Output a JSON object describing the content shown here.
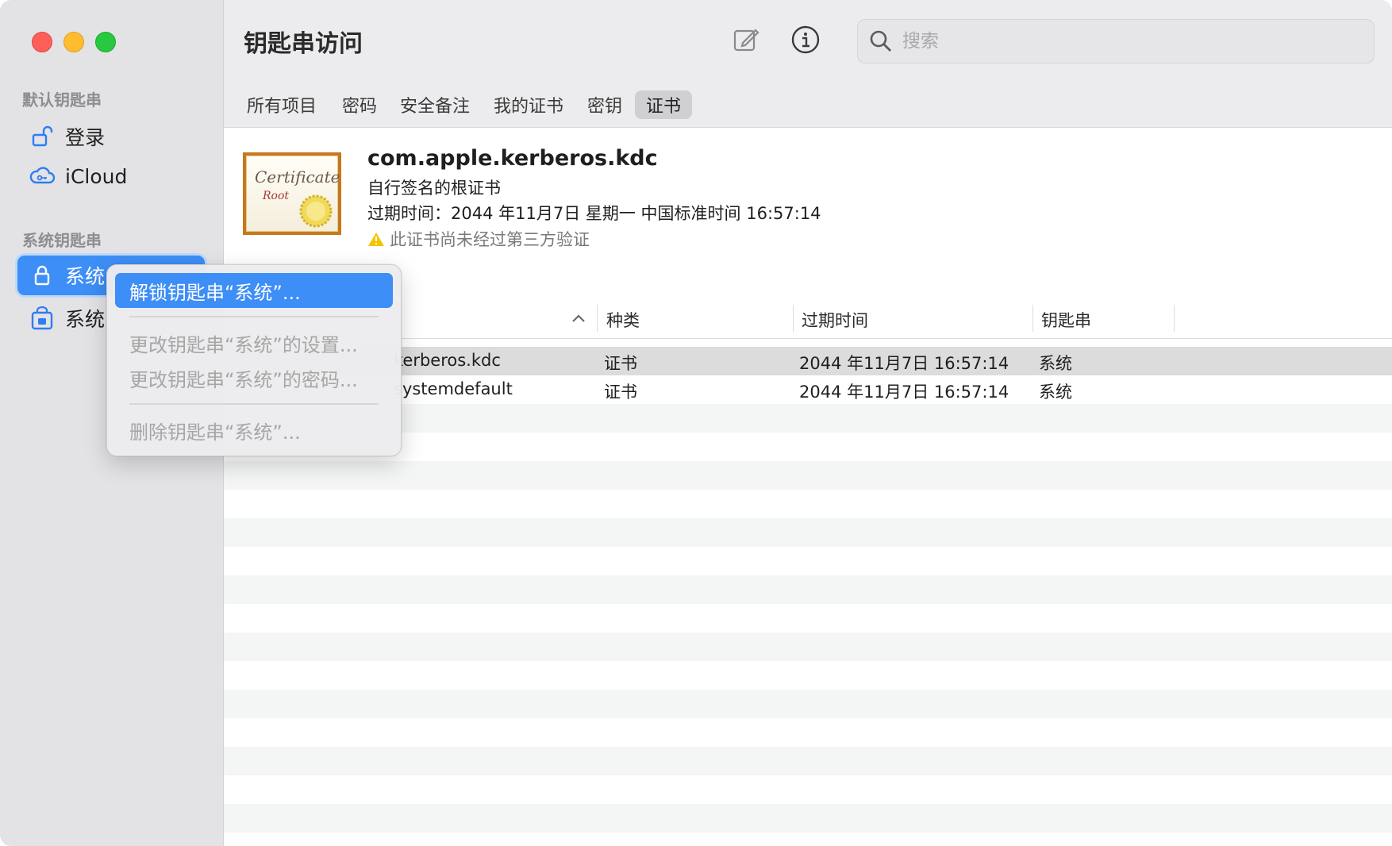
{
  "app": {
    "title": "钥匙串访问"
  },
  "search": {
    "placeholder": "搜索"
  },
  "sidebar": {
    "default_section": "默认钥匙串",
    "default_items": [
      {
        "label": "登录",
        "icon": "unlock-icon"
      },
      {
        "label": "iCloud",
        "icon": "icloud-icon"
      }
    ],
    "system_section": "系统钥匙串",
    "system_items": [
      {
        "label": "系统",
        "icon": "lock-icon",
        "selected": true
      },
      {
        "label": "系统",
        "icon": "lock-box-icon"
      }
    ]
  },
  "tabs": [
    "所有项目",
    "密码",
    "安全备注",
    "我的证书",
    "密钥",
    "证书"
  ],
  "active_tab": "证书",
  "detail": {
    "name": "com.apple.kerberos.kdc",
    "subtitle": "自行签名的根证书",
    "expires": "过期时间：2044 年11月7日 星期一 中国标准时间 16:57:14",
    "warning": "此证书尚未经过第三方验证",
    "cert_script": "Certificate",
    "cert_root": "Root"
  },
  "table": {
    "columns": [
      "种类",
      "过期时间",
      "钥匙串"
    ],
    "rows": [
      {
        "name": "kerberos.kdc",
        "kind": "证书",
        "expires": "2044 年11月7日 16:57:14",
        "keychain": "系统"
      },
      {
        "name": "systemdefault",
        "kind": "证书",
        "expires": "2044 年11月7日 16:57:14",
        "keychain": "系统"
      }
    ]
  },
  "context_menu": {
    "items": [
      "解锁钥匙串“系统”...",
      "更改钥匙串“系统”的设置...",
      "更改钥匙串“系统”的密码...",
      "删除钥匙串“系统”..."
    ]
  },
  "colors": {
    "accent": "#3d8ef6",
    "warning": "#f5c400"
  }
}
